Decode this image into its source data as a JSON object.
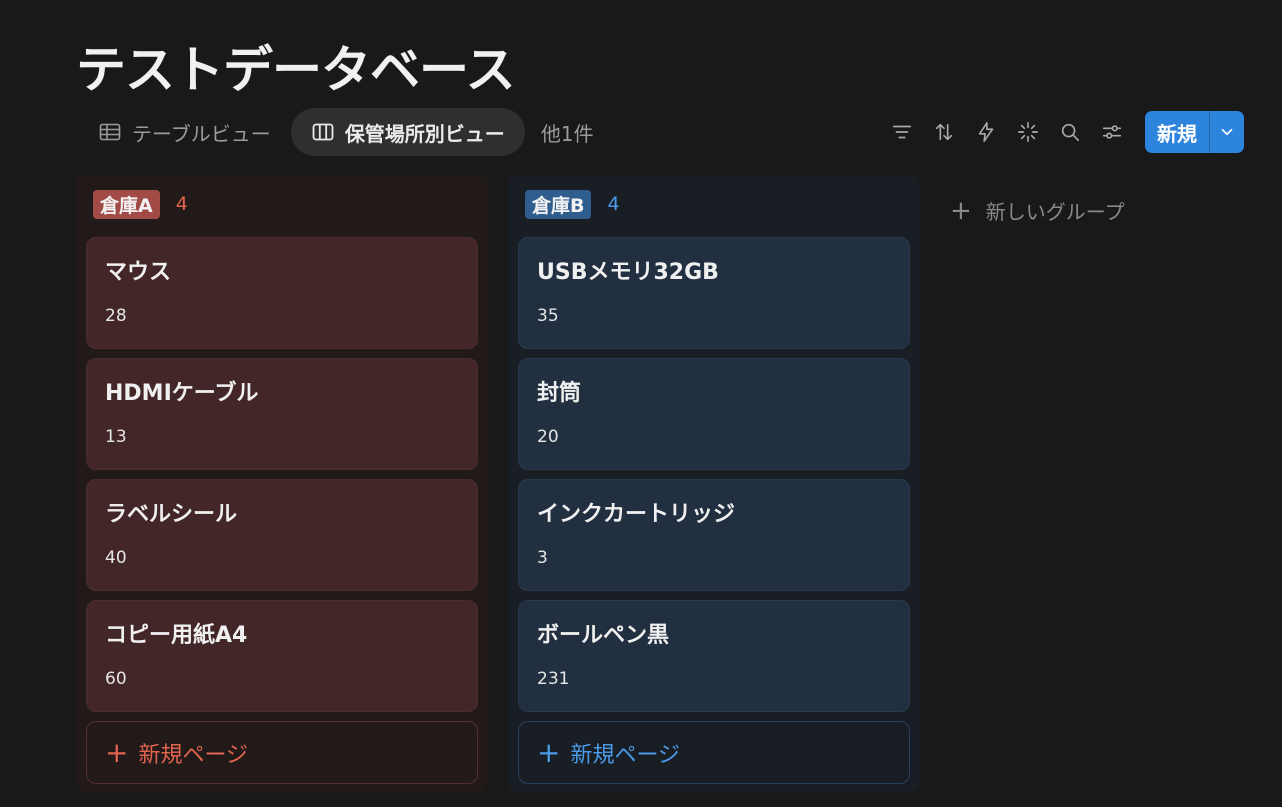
{
  "title": "テストデータベース",
  "tabs": [
    {
      "label": "テーブルビュー",
      "icon": "table-icon",
      "active": false
    },
    {
      "label": "保管場所別ビュー",
      "icon": "board-icon",
      "active": true
    }
  ],
  "tabs_more": "他1件",
  "toolbar": {
    "icons": [
      "filter-icon",
      "sort-icon",
      "automation-icon",
      "ai-sparkle-icon",
      "search-icon",
      "settings-sliders-icon"
    ],
    "new_label": "新規"
  },
  "columns": [
    {
      "name": "倉庫A",
      "count": "4",
      "color": "#a24a45",
      "cards": [
        {
          "title": "マウス",
          "qty": "28"
        },
        {
          "title": "HDMIケーブル",
          "qty": "13"
        },
        {
          "title": "ラベルシール",
          "qty": "40"
        },
        {
          "title": "コピー用紙A4",
          "qty": "60"
        }
      ],
      "add_label": "新規ページ"
    },
    {
      "name": "倉庫B",
      "count": "4",
      "color": "#2f5d8d",
      "cards": [
        {
          "title": "USBメモリ32GB",
          "qty": "35"
        },
        {
          "title": "封筒",
          "qty": "20"
        },
        {
          "title": "インクカートリッジ",
          "qty": "3"
        },
        {
          "title": "ボールペン黒",
          "qty": "231"
        }
      ],
      "add_label": "新規ページ"
    }
  ],
  "new_group_label": "新しいグループ",
  "colors": {
    "accent": "#2d84dd",
    "background": "#191919"
  }
}
